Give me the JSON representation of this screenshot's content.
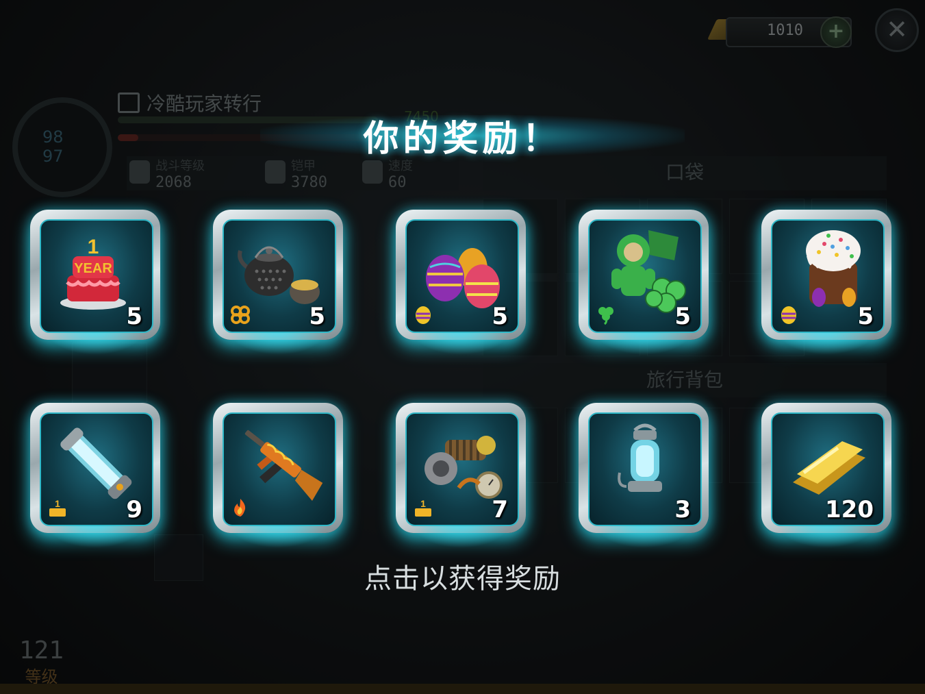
{
  "header": {
    "gold_amount": "1010",
    "add_gold_label": "+",
    "close_label": "✕"
  },
  "player": {
    "name": "冷酷玩家转行",
    "gauge_a": "98",
    "gauge_b": "97",
    "xp": "7450",
    "stats": [
      {
        "label": "战斗等级",
        "value": "2068"
      },
      {
        "label": "铠甲",
        "value": "3780"
      },
      {
        "label": "速度",
        "value": "60"
      }
    ],
    "level_number": "121",
    "level_label": "等级"
  },
  "inventory": {
    "pocket_label": "口袋",
    "travel_bag_label": "旅行背包"
  },
  "dialog": {
    "title": "你的奖励！",
    "hint": "点击以获得奖励",
    "rewards": [
      {
        "item": "anniversary-cake",
        "count": "5",
        "badge": "none"
      },
      {
        "item": "teapot",
        "count": "5",
        "badge": "knot"
      },
      {
        "item": "easter-eggs",
        "count": "5",
        "badge": "egg"
      },
      {
        "item": "shamrock-cookies",
        "count": "5",
        "badge": "clover"
      },
      {
        "item": "easter-cake",
        "count": "5",
        "badge": "egg"
      },
      {
        "item": "energy-capsule",
        "count": "9",
        "badge": "cake"
      },
      {
        "item": "flame-rifle",
        "count": "",
        "badge": "fire"
      },
      {
        "item": "mechanical-parts",
        "count": "7",
        "badge": "cake"
      },
      {
        "item": "lantern",
        "count": "3",
        "badge": "none"
      },
      {
        "item": "gold-bar",
        "count": "120",
        "badge": "none"
      }
    ]
  },
  "colors": {
    "tile_glow": "#3ce6fa",
    "title_glow": "#28c8dc",
    "tile_inner": "#0f3b47"
  }
}
